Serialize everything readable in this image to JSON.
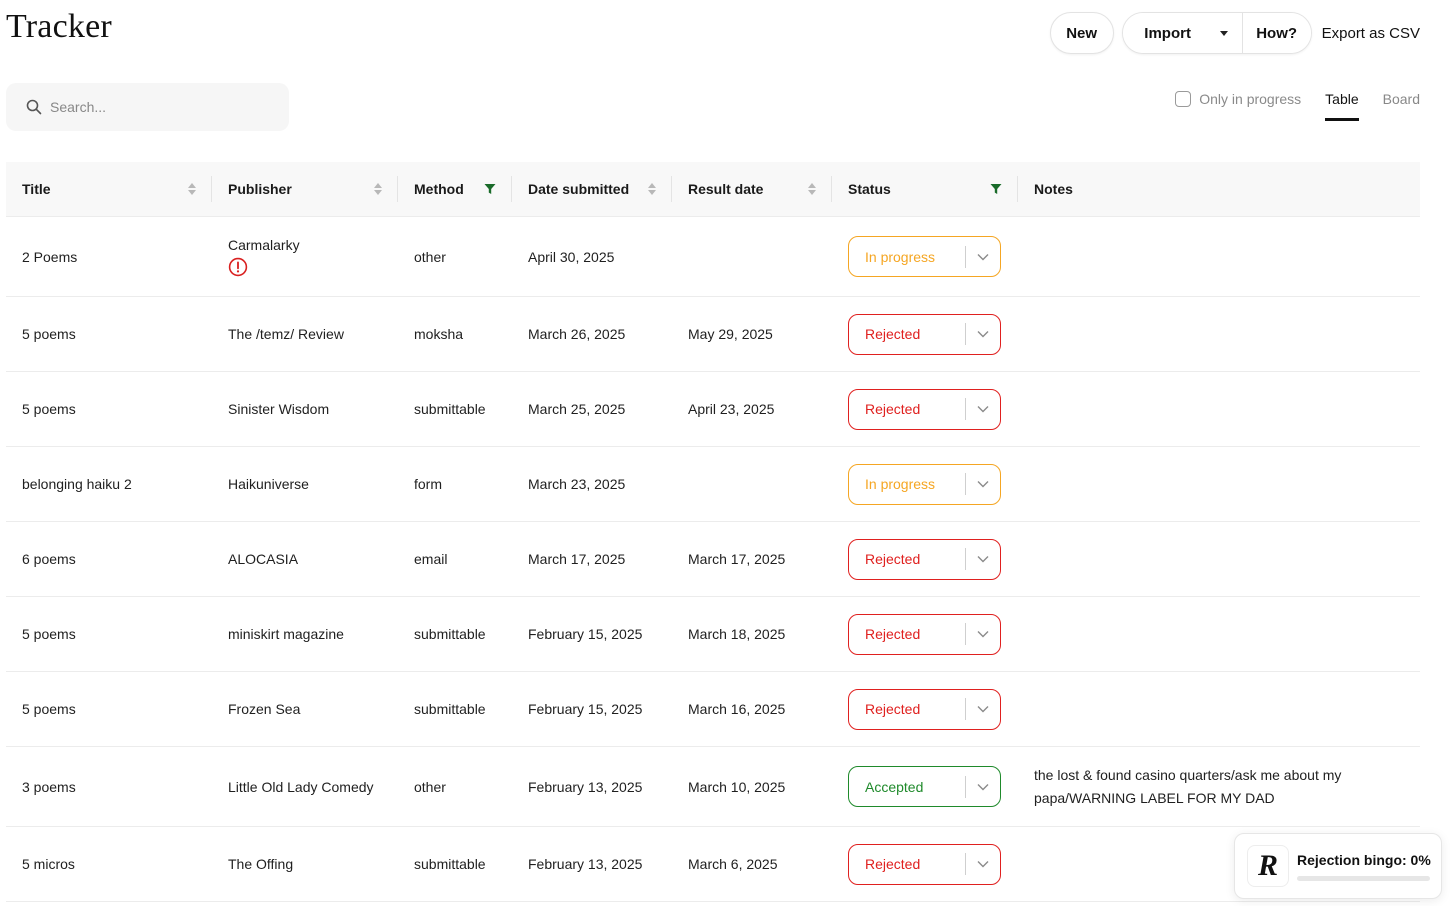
{
  "app": {
    "title": "Tracker"
  },
  "actions": {
    "new_label": "New",
    "import_label": "Import",
    "how_label": "How?",
    "export_label": "Export as CSV"
  },
  "search": {
    "placeholder": "Search..."
  },
  "view": {
    "only_in_progress_label": "Only in progress",
    "only_in_progress_checked": false,
    "tabs": [
      "Table",
      "Board"
    ],
    "active_tab": "Table"
  },
  "table": {
    "columns": [
      "Title",
      "Publisher",
      "Method",
      "Date submitted",
      "Result date",
      "Status",
      "Notes"
    ],
    "rows": [
      {
        "title": "2 Poems",
        "publisher": "Carmalarky",
        "publisher_warning": true,
        "method": "other",
        "date_submitted": "April 30, 2025",
        "result_date": "",
        "status": "In progress",
        "notes": ""
      },
      {
        "title": "5 poems",
        "publisher": "The /temz/ Review",
        "method": "moksha",
        "date_submitted": "March 26, 2025",
        "result_date": "May 29, 2025",
        "status": "Rejected",
        "notes": ""
      },
      {
        "title": "5 poems",
        "publisher": "Sinister Wisdom",
        "method": "submittable",
        "date_submitted": "March 25, 2025",
        "result_date": "April 23, 2025",
        "status": "Rejected",
        "notes": ""
      },
      {
        "title": "belonging haiku 2",
        "publisher": "Haikuniverse",
        "method": "form",
        "date_submitted": "March 23, 2025",
        "result_date": "",
        "status": "In progress",
        "notes": ""
      },
      {
        "title": "6 poems",
        "publisher": "ALOCASIA",
        "method": "email",
        "date_submitted": "March 17, 2025",
        "result_date": "March 17, 2025",
        "status": "Rejected",
        "notes": ""
      },
      {
        "title": "5 poems",
        "publisher": "miniskirt magazine",
        "method": "submittable",
        "date_submitted": "February 15, 2025",
        "result_date": "March 18, 2025",
        "status": "Rejected",
        "notes": ""
      },
      {
        "title": "5 poems",
        "publisher": "Frozen Sea",
        "method": "submittable",
        "date_submitted": "February 15, 2025",
        "result_date": "March 16, 2025",
        "status": "Rejected",
        "notes": ""
      },
      {
        "title": "3 poems",
        "publisher": "Little Old Lady Comedy",
        "method": "other",
        "date_submitted": "February 13, 2025",
        "result_date": "March 10, 2025",
        "status": "Accepted",
        "notes": "the lost & found casino quarters/ask me about my papa/WARNING LABEL FOR MY DAD"
      },
      {
        "title": "5 micros",
        "publisher": "The Offing",
        "method": "submittable",
        "date_submitted": "February 13, 2025",
        "result_date": "March 6, 2025",
        "status": "Rejected",
        "notes": ""
      }
    ]
  },
  "status_colors": {
    "In progress": "#f5a623",
    "Rejected": "#e0201f",
    "Accepted": "#1f8a2b"
  },
  "filter_color": "#1a6b2a",
  "warning_color": "#d92020",
  "bingo": {
    "logo": "R",
    "label": "Rejection bingo: 0%",
    "progress_percent": 0
  }
}
